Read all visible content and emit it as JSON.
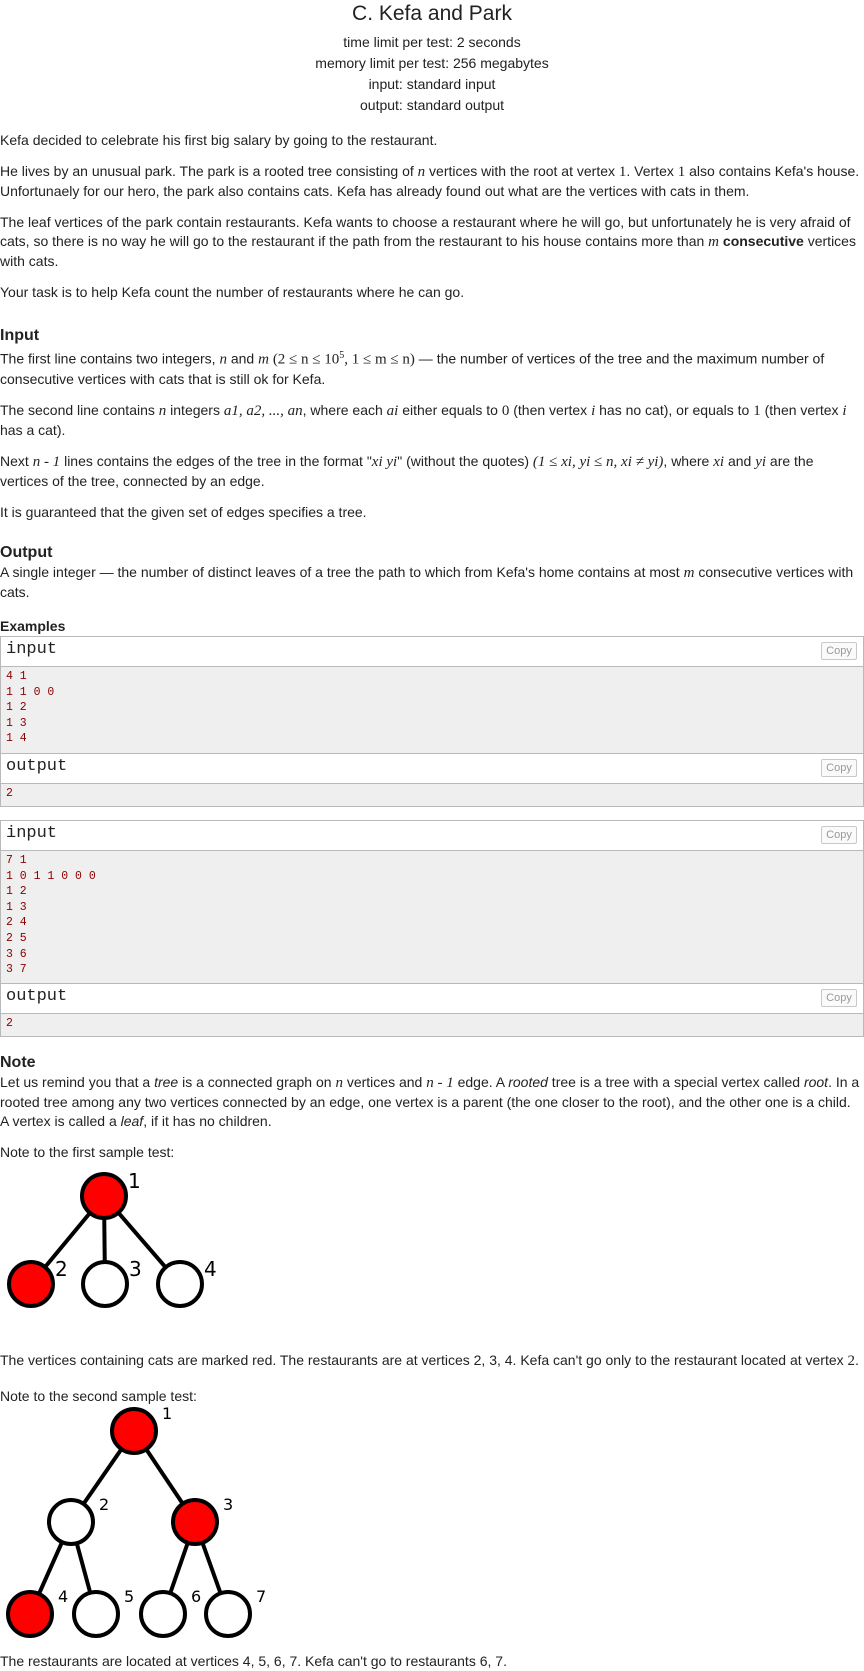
{
  "header": {
    "title": "C. Kefa and Park",
    "time_limit": "time limit per test: 2 seconds",
    "memory_limit": "memory limit per test: 256 megabytes",
    "input": "input: standard input",
    "output": "output: standard output"
  },
  "statement": {
    "p1": "Kefa decided to celebrate his first big salary by going to the restaurant.",
    "p2": {
      "a": "He lives by an unusual park. The park is a rooted tree consisting of ",
      "n": "n",
      "b": " vertices with the root at vertex ",
      "one1": "1",
      "c": ". Vertex ",
      "one2": "1",
      "d": " also contains Kefa's house. Unfortunaely for our hero, the park also contains cats. Kefa has already found out what are the vertices with cats in them."
    },
    "p3": {
      "a": "The leaf vertices of the park contain restaurants. Kefa wants to choose a restaurant where he will go, but unfortunately he is very afraid of cats, so there is no way he will go to the restaurant if the path from the restaurant to his house contains more than ",
      "m": "m",
      "bold": "consecutive",
      "b": " vertices with cats."
    },
    "p4": "Your task is to help Kefa count the number of restaurants where he can go."
  },
  "input_section": {
    "heading": "Input",
    "p1": {
      "a": "The first line contains two integers, ",
      "n": "n",
      "and": " and ",
      "m": "m",
      "constraint": "(2 ≤ n ≤ 10",
      "exp": "5",
      "constraint2": ", 1 ≤ m ≤ n)",
      "b": " — the number of vertices of the tree and the maximum number of consecutive vertices with cats that is still ok for Kefa."
    },
    "p2": {
      "a": "The second line contains ",
      "n": "n",
      "b": " integers ",
      "seq": "a1, a2, ..., an",
      "c": ", where each ",
      "ai": "ai",
      "d": " either equals to ",
      "zero": "0",
      "e": " (then vertex ",
      "i1": "i",
      "f": " has no cat), or equals to ",
      "one": "1",
      "g": " (then vertex ",
      "i2": "i",
      "h": " has a cat)."
    },
    "p3": {
      "a": "Next ",
      "nm1": "n - 1",
      "b": " lines contains the edges of the tree in the format \"",
      "fmt": "xi yi",
      "c": "\" (without the quotes) ",
      "cons": "(1 ≤ xi, yi ≤ n, xi ≠ yi)",
      "d": ", where ",
      "xi": "xi",
      "and": " and ",
      "yi": "yi",
      "e": " are the vertices of the tree, connected by an edge."
    },
    "p4": "It is guaranteed that the given set of edges specifies a tree."
  },
  "output_section": {
    "heading": "Output",
    "a": "A single integer — the number of distinct leaves of a tree the path to which from Kefa's home contains at most ",
    "m": "m",
    "b": " consecutive vertices with cats."
  },
  "examples": {
    "heading": "Examples",
    "input_label": "input",
    "output_label": "output",
    "copy_label": "Copy",
    "ex1_input": "4 1\n1 1 0 0\n1 2\n1 3\n1 4",
    "ex1_output": "2",
    "ex2_input": "7 1\n1 0 1 1 0 0 0\n1 2\n1 3\n2 4\n2 5\n3 6\n3 7",
    "ex2_output": "2"
  },
  "note": {
    "heading": "Note",
    "p1": {
      "a": "Let us remind you that a ",
      "tree": "tree",
      "b": " is a connected graph on ",
      "n": "n",
      "c": " vertices and ",
      "nm1": "n - 1",
      "d": " edge. A ",
      "rooted": "rooted",
      "e": " tree is a tree with a special vertex called ",
      "root": "root",
      "f": ". In a rooted tree among any two vertices connected by an edge, one vertex is a parent (the one closer to the root), and the other one is a child. A vertex is called a ",
      "leaf": "leaf",
      "g": ", if it has no children."
    },
    "first_label": "Note to the first sample test:",
    "first_text": "The vertices containing cats are marked red. The restaurants are at vertices 2, 3, 4. Kefa can't go only to the restaurant located at vertex ",
    "first_two": "2",
    "first_end": ".",
    "second_label": "Note to the second sample test:",
    "second_text": "The restaurants are located at vertices 4, 5, 6, 7. Kefa can't go to restaurants 6, 7."
  },
  "tree1": {
    "labels": [
      "1",
      "2",
      "3",
      "4"
    ],
    "cats": [
      1,
      1,
      0,
      0
    ]
  },
  "tree2": {
    "labels": [
      "1",
      "2",
      "3",
      "4",
      "5",
      "6",
      "7"
    ],
    "cats": [
      1,
      0,
      1,
      1,
      0,
      0,
      0
    ]
  },
  "colors": {
    "cat": "#ff0000",
    "nocat": "#ffffff",
    "stroke": "#000000",
    "sample_text": "#8b0000"
  }
}
